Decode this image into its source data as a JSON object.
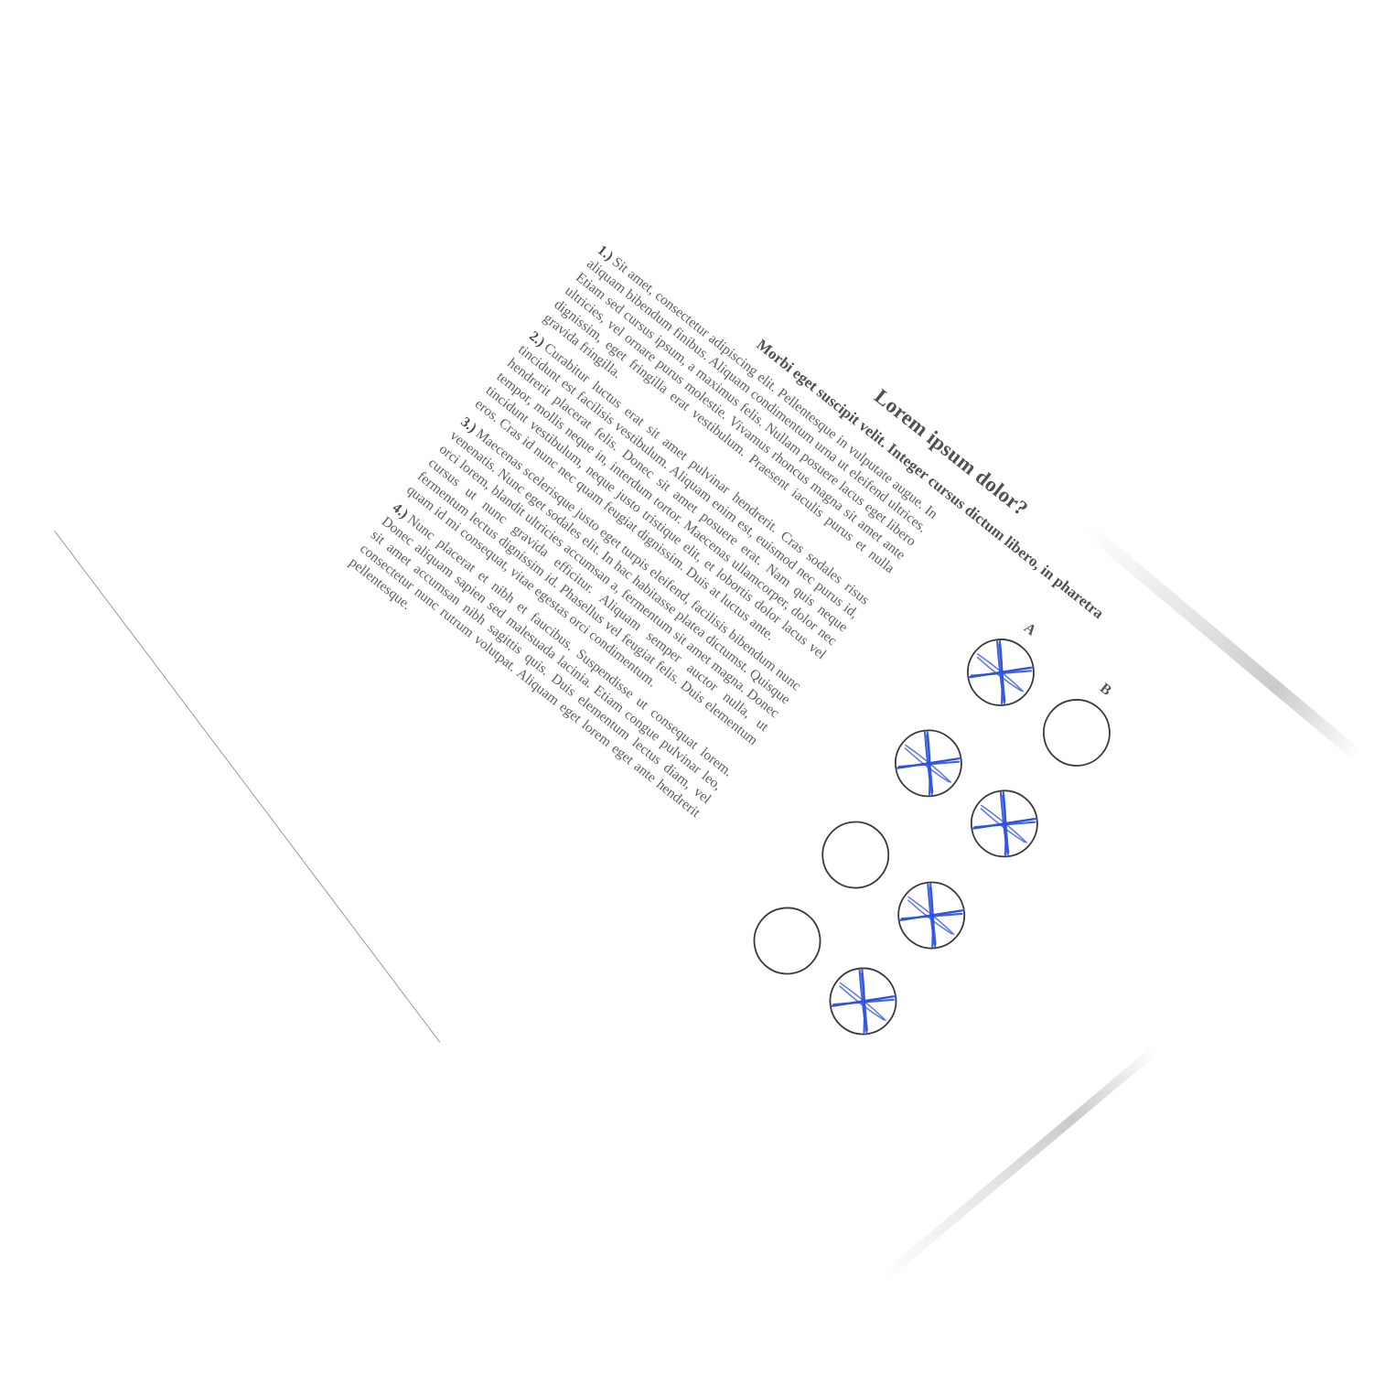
{
  "document": {
    "title": "Lorem ipsum dolor?",
    "subtitle": "Morbi eget suscipit velit. Integer cursus dictum libero, in pharetra",
    "columns": [
      "A",
      "B"
    ],
    "questions": [
      {
        "number": "1.)",
        "text": "Sit amet, consectetur adipiscing elit. Pellentesque in vulputate augue. In aliquam bibendum finibus. Aliquam condimentum urna ut eleifend ultrices. Etiam sed cursus ipsum, a maximus felis. Nullam posuere lacus eget libero ultricies, vel ornare purus molestie. Vivamus rhoncus magna sit amet ante dignissim, eget fringilla erat vestibulum. Praesent iaculis purus et nulla gravida fringilla.",
        "answers": {
          "A": "marked",
          "B": "empty"
        }
      },
      {
        "number": "2.)",
        "text": "Curabitur luctus erat sit amet pulvinar hendrerit. Cras sodales risus tincidunt est facilisis vestibulum. Aliquam enim est, euismod nec purus id, hendrerit placerat felis. Donec sit amet posuere erat. Nam quis neque tempor, mollis neque in, interdum tortor. Maecenas ullamcorper, dolor nec tincidunt vestibulum, neque justo tristique elit, et lobortis dolor lacus vel eros. Cras id nunc nec quam feugiat dignissim. Duis at luctus ante.",
        "answers": {
          "A": "marked",
          "B": "marked"
        }
      },
      {
        "number": "3.)",
        "text": "Maecenas scelerisque justo eget turpis eleifend, facilisis bibendum nunc venenatis. Nunc eget sodales elit. In hac habitasse platea dictumst. Quisque orci lorem, blandit ultricies accumsan a, fermentum sit amet magna. Donec cursus ut nunc gravida efficitur. Aliquam semper auctor nulla, ut fermentum lectus dignissim id. Phasellus vel feugiat felis. Duis elementum quam id mi consequat, vitae egestas orci condimentum.",
        "answers": {
          "A": "empty",
          "B": "marked"
        }
      },
      {
        "number": "4.)",
        "text": "Nunc placerat et nibh et faucibus. Suspendisse ut consequat lorem. Donec aliquam sapien sed malesuada lacinia. Etiam congue pulvinar leo, sit amet accumsan nibh sagittis quis. Duis elementum lectus diam, vel consectetur nunc rutrum volutpat. Aliquam eget lorem eget ante hendrerit pellentesque.",
        "answers": {
          "A": "empty",
          "B": "marked"
        }
      }
    ]
  },
  "colors": {
    "paper": "#ffffff",
    "text": "#5c5c5c",
    "bubble_outline": "#3a3a3a",
    "pen_mark": "#2f52d8"
  }
}
